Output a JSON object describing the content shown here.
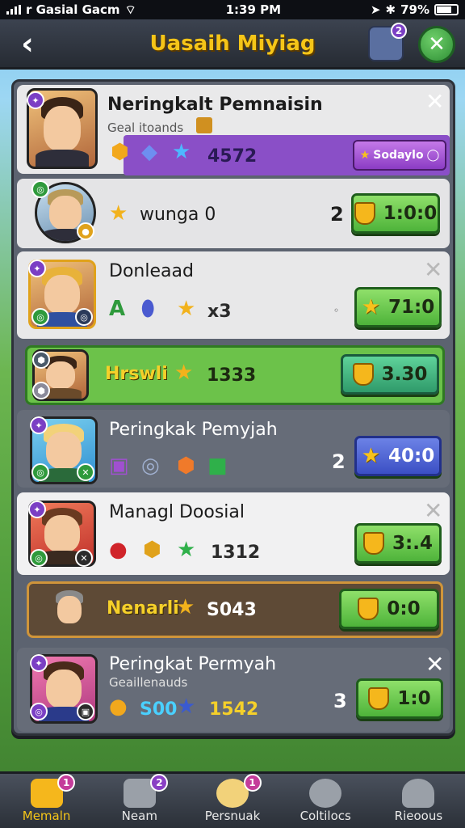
{
  "status_bar": {
    "carrier": "r Gasial Gacm",
    "time": "1:39 PM",
    "battery": "79%"
  },
  "header": {
    "title": "Uasaih Miyiag",
    "chest_badge": "2"
  },
  "rows": [
    {
      "name": "Neringkalt Pemnaisin",
      "subtitle": "Geal itoands",
      "value": "4572",
      "special_label": "Sodaylo"
    },
    {
      "name": "wunga 0",
      "rank": "2",
      "button": "1:0:0"
    },
    {
      "name": "Donleaad",
      "value": "x3",
      "button": "71:0"
    },
    {
      "name": "Hrswli",
      "value": "1333",
      "button": "3.30"
    },
    {
      "name": "Peringkak Pemyjah",
      "rank": "2",
      "button": "40:0"
    },
    {
      "name": "Managl Doosial",
      "value": "1312",
      "button": "3:.4"
    },
    {
      "name": "Nenarli",
      "value": "S043",
      "button": "0:0"
    },
    {
      "name": "Peringkat Permyah",
      "subtitle": "Geaillenauds",
      "stat_a": "S00",
      "value": "1542",
      "rank": "3",
      "button": "1:0"
    }
  ],
  "nav": [
    {
      "label": "Memaln",
      "badge": "1"
    },
    {
      "label": "Neam",
      "badge": "2"
    },
    {
      "label": "Persnuak",
      "badge": "1"
    },
    {
      "label": "Coltilocs"
    },
    {
      "label": "Rieoous"
    }
  ],
  "colors": {
    "accent": "#f5c518",
    "panel": "#5c6370",
    "green_btn": "#4eb33a",
    "purple": "#8a4fc7"
  }
}
